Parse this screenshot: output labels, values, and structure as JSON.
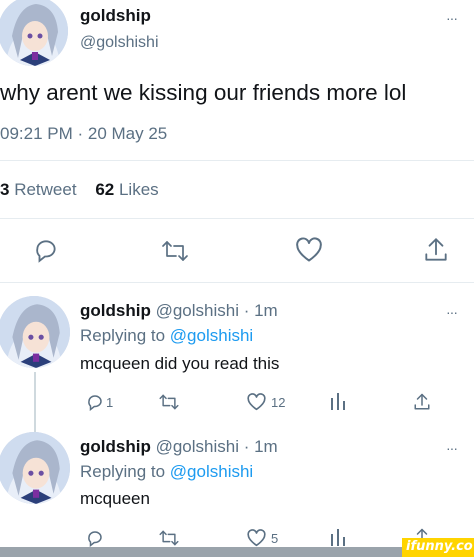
{
  "tweet": {
    "display_name": "goldship",
    "handle": "@golshishi",
    "text": "why arent we kissing our friends more lol",
    "timestamp": "09:21 PM · 20 May 25",
    "retweets_count": "3",
    "retweets_label": "Retweet",
    "likes_count": "62",
    "likes_label": "Likes",
    "more_glyph": "···"
  },
  "replies": [
    {
      "display_name": "goldship",
      "handle_time": "@golshishi · 1m",
      "replying_prefix": "Replying to",
      "replying_to": "@golshishi",
      "text": "mcqueen did you read this",
      "reply_count": "1",
      "like_count": "12",
      "more_glyph": "···"
    },
    {
      "display_name": "goldship",
      "handle_time": "@golshishi · 1m",
      "replying_prefix": "Replying to",
      "replying_to": "@golshishi",
      "text": "mcqueen",
      "reply_count": "",
      "like_count": "5",
      "more_glyph": "···"
    }
  ],
  "watermark": "ifunny.co",
  "colors": {
    "text": "#111418",
    "muted": "#5b7083",
    "link": "#1d9bf0",
    "divider": "#e6ecf0",
    "watermark_bg": "#ffd400"
  },
  "icons": [
    "reply-icon",
    "retweet-icon",
    "like-icon",
    "share-icon",
    "analytics-icon",
    "more-icon"
  ]
}
